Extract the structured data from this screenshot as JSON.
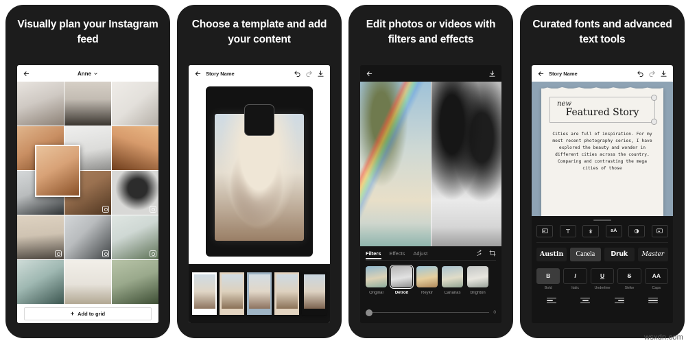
{
  "panels": [
    {
      "id": "plan-feed",
      "title": "Visually plan your Instagram feed",
      "appbar": {
        "back_icon": "back-arrow-icon",
        "account": "Anne",
        "chevron": "chevron-down-icon"
      },
      "grid": {
        "add_button": {
          "label": "Add to grid",
          "plus": "+"
        },
        "tiles": [
          {
            "name": "woman-walking-corridor",
            "c1": "#cfc9c3",
            "c2": "#8c8176",
            "badge": false
          },
          {
            "name": "minimal-interior-bed",
            "c1": "#c3bcb3",
            "c2": "#6f6257",
            "badge": false
          },
          {
            "name": "white-tiles-still-life",
            "c1": "#e3e0db",
            "c2": "#b5afa7",
            "badge": false
          },
          {
            "name": "canyon-wall-orange",
            "c1": "#c98f63",
            "c2": "#7d4a25",
            "badge": false
          },
          {
            "name": "white-building-stairs",
            "c1": "#dcdcda",
            "c2": "#8e8e8c",
            "badge": false
          },
          {
            "name": "canyon-curve-warm",
            "c1": "#d79b6c",
            "c2": "#6e3d1c",
            "badge": false
          },
          {
            "name": "rocky-shore-bw",
            "c1": "#b9bcbd",
            "c2": "#3b3f41",
            "badge": false
          },
          {
            "name": "desert-plants-aerial",
            "c1": "#9a7150",
            "c2": "#4e3520",
            "badge": true
          },
          {
            "name": "palm-tree-bw",
            "c1": "#d8d8d6",
            "c2": "#2c2c2c",
            "badge": true
          },
          {
            "name": "beige-shadow-wall",
            "c1": "#cfc3b2",
            "c2": "#6b6258",
            "badge": true
          },
          {
            "name": "surfboard-shadow",
            "c1": "#b9bcbe",
            "c2": "#5f6365",
            "badge": true
          },
          {
            "name": "rainbow-palm-beach",
            "c1": "#cfd8d4",
            "c2": "#7c8f74",
            "badge": true
          },
          {
            "name": "surfboard-ocean",
            "c1": "#9fb8b2",
            "c2": "#4f6d68",
            "badge": false
          },
          {
            "name": "desert-dune-figures",
            "c1": "#e6e2da",
            "c2": "#b2a893",
            "badge": false
          },
          {
            "name": "green-wave-cliff",
            "c1": "#9aa98c",
            "c2": "#4a5b3f",
            "badge": false
          }
        ],
        "drag_tile": {
          "name": "canyon-wall-dragged",
          "c1": "#d8a277",
          "c2": "#8a5128"
        }
      }
    },
    {
      "id": "choose-template",
      "title": "Choose a template and add your content",
      "appbar": {
        "back_icon": "back-arrow-icon",
        "story_name": "Story Name",
        "undo_icon": "undo-icon",
        "redo_icon": "redo-icon",
        "download_icon": "download-icon"
      },
      "canvas": {
        "photo_name": "woman-straw-hat-sunglasses",
        "placeholder": "media-placeholder-box"
      },
      "thumbnails": [
        {
          "name": "template-white",
          "style": "white"
        },
        {
          "name": "template-tan",
          "style": "tan"
        },
        {
          "name": "template-blue-selected",
          "style": "sel"
        },
        {
          "name": "template-beige",
          "style": "tan"
        },
        {
          "name": "template-dark",
          "style": "dk"
        }
      ]
    },
    {
      "id": "edit-photos",
      "title": "Edit photos or videos with filters and effects",
      "appbar": {
        "back_icon": "back-arrow-icon",
        "download_icon": "download-icon"
      },
      "canvas": {
        "left_name": "rainbow-beach-color",
        "right_name": "rainbow-beach-bw"
      },
      "tabs": [
        {
          "label": "Filters",
          "active": true
        },
        {
          "label": "Effects",
          "active": false
        },
        {
          "label": "Adjust",
          "active": false
        }
      ],
      "tab_icons": [
        {
          "name": "shuffle-icon"
        },
        {
          "name": "crop-icon"
        }
      ],
      "filters": [
        {
          "label": "Original",
          "selected": false
        },
        {
          "label": "Detroit",
          "selected": true
        },
        {
          "label": "Reykir",
          "selected": false
        },
        {
          "label": "Canarias",
          "selected": false
        },
        {
          "label": "Brighton",
          "selected": false
        }
      ],
      "slider": {
        "value": "0"
      }
    },
    {
      "id": "fonts-text-tools",
      "title": "Curated fonts and advanced text tools",
      "appbar": {
        "back_icon": "back-arrow-icon",
        "story_name": "Story Name",
        "undo_icon": "undo-icon",
        "redo_icon": "redo-icon",
        "download_icon": "download-icon"
      },
      "canvas": {
        "heading_script": "new",
        "heading_main": "Featured Story",
        "body": "Cities are full of inspiration. For my most recent photography series, I have explored the beauty and wonder in different cities across the country. Comparing and contrasting the mega cities of those"
      },
      "tool_icons": [
        {
          "name": "text-box-icon",
          "glyph": "▭"
        },
        {
          "name": "text-type-icon",
          "glyph": "T"
        },
        {
          "name": "text-color-icon",
          "glyph": "✜"
        },
        {
          "name": "text-case-icon",
          "glyph": "aA"
        },
        {
          "name": "opacity-icon",
          "glyph": "◑"
        },
        {
          "name": "text-background-icon",
          "glyph": "▣"
        }
      ],
      "fonts": [
        {
          "label": "Austin",
          "selected": false,
          "cls": "f-austin"
        },
        {
          "label": "Canela",
          "selected": true,
          "cls": "f-canela"
        },
        {
          "label": "Druk",
          "selected": false,
          "cls": "f-druk"
        },
        {
          "label": "Master",
          "selected": false,
          "cls": "f-master"
        }
      ],
      "styles": [
        {
          "glyph": "B",
          "label": "Bold",
          "selected": true
        },
        {
          "glyph": "I",
          "label": "Italic",
          "selected": false
        },
        {
          "glyph": "U",
          "label": "Underline",
          "selected": false
        },
        {
          "glyph": "S",
          "label": "Strike",
          "selected": false
        },
        {
          "glyph": "AA",
          "label": "Caps",
          "selected": false
        }
      ],
      "alignments": [
        {
          "name": "align-left-button"
        },
        {
          "name": "align-center-button"
        },
        {
          "name": "align-right-button"
        },
        {
          "name": "align-justify-button"
        }
      ]
    }
  ],
  "watermark": "wsxdn.com"
}
